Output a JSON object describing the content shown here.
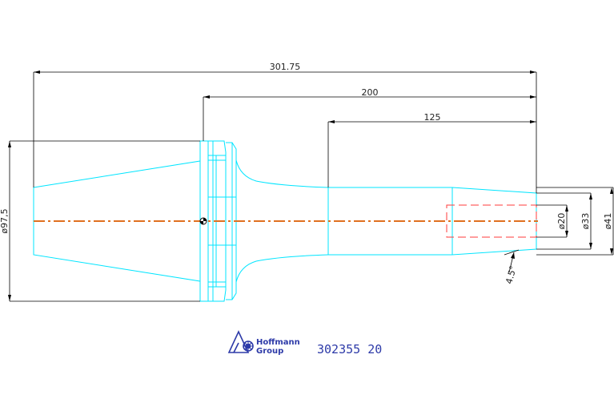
{
  "drawing": {
    "dimensions": {
      "overall_length": "301.75",
      "length_from_flange": "200",
      "length_from_shank": "125",
      "flange_diameter": "ø97,5",
      "bore_diameter": "ø20",
      "tip_inner_diameter": "ø33",
      "tip_outer_diameter": "ø41",
      "taper_angle": "4.5°"
    },
    "logo": {
      "line1": "Hoffmann",
      "line2": "Group",
      "icon": "hoffmann-logo-icon"
    },
    "part_number": "302355 20"
  },
  "colors": {
    "outline": "#00e5ff",
    "dimension": "#000000",
    "centerline": "#e07020",
    "hidden_bore": "#ff3b3b",
    "brand": "#2d3aa8"
  }
}
